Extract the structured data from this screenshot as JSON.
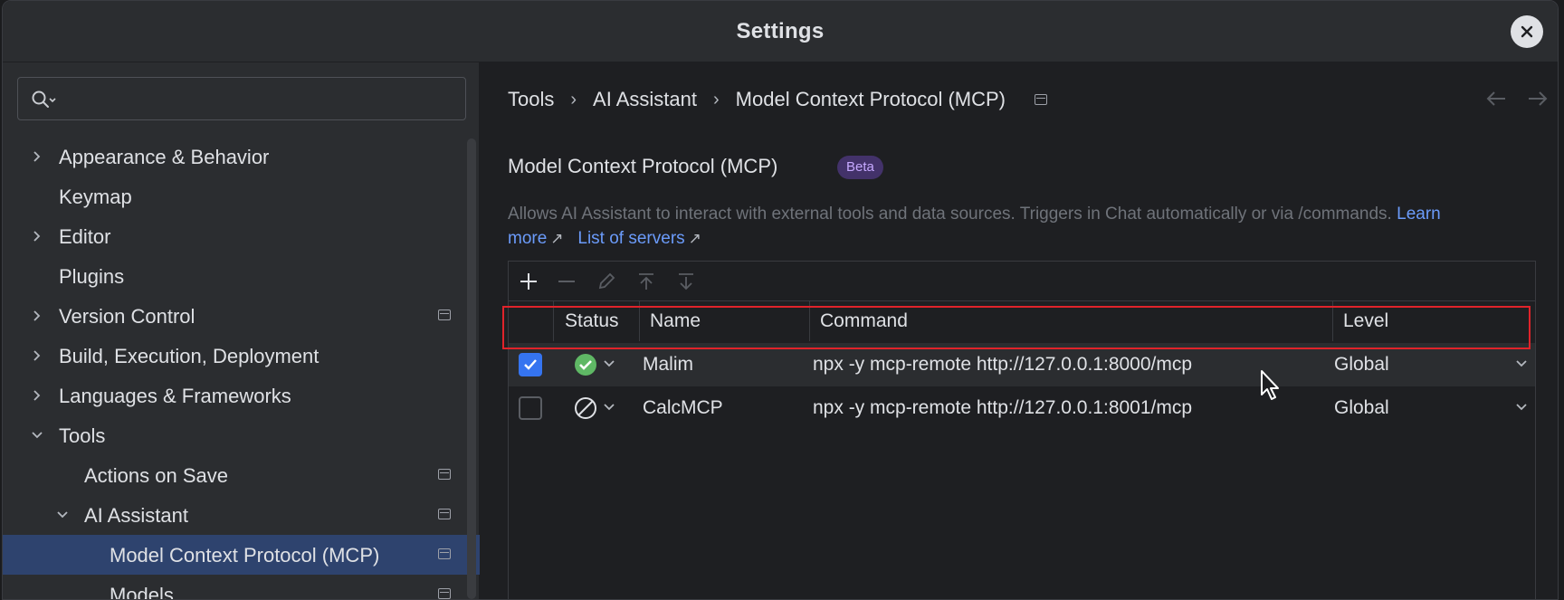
{
  "window": {
    "title": "Settings"
  },
  "sidebar": {
    "search_placeholder": "",
    "items": [
      {
        "label": "Appearance & Behavior",
        "expandable": true,
        "expanded": false,
        "indent": 0,
        "pinned": false
      },
      {
        "label": "Keymap",
        "expandable": false,
        "indent": 0,
        "pinned": false
      },
      {
        "label": "Editor",
        "expandable": true,
        "expanded": false,
        "indent": 0,
        "pinned": false
      },
      {
        "label": "Plugins",
        "expandable": false,
        "indent": 0,
        "pinned": false
      },
      {
        "label": "Version Control",
        "expandable": true,
        "expanded": false,
        "indent": 0,
        "pinned": true
      },
      {
        "label": "Build, Execution, Deployment",
        "expandable": true,
        "expanded": false,
        "indent": 0,
        "pinned": false
      },
      {
        "label": "Languages & Frameworks",
        "expandable": true,
        "expanded": false,
        "indent": 0,
        "pinned": false
      },
      {
        "label": "Tools",
        "expandable": true,
        "expanded": true,
        "indent": 0,
        "pinned": false
      },
      {
        "label": "Actions on Save",
        "expandable": false,
        "indent": 1,
        "pinned": true
      },
      {
        "label": "AI Assistant",
        "expandable": true,
        "expanded": true,
        "indent": 1,
        "pinned": true
      },
      {
        "label": "Model Context Protocol (MCP)",
        "expandable": false,
        "indent": 2,
        "pinned": true,
        "selected": true
      },
      {
        "label": "Models",
        "expandable": false,
        "indent": 2,
        "pinned": true
      }
    ]
  },
  "breadcrumb": {
    "items": [
      "Tools",
      "AI Assistant",
      "Model Context Protocol (MCP)"
    ],
    "separator": "›"
  },
  "main": {
    "title": "Model Context Protocol (MCP)",
    "badge": "Beta",
    "description_text": "Allows AI Assistant to interact with external tools and data sources. Triggers in Chat automatically or via /commands.",
    "learn_more": "Learn more",
    "list_of_servers": "List of servers",
    "ext_arrow": "↗"
  },
  "table": {
    "columns": [
      "Status",
      "Name",
      "Command",
      "Level"
    ],
    "rows": [
      {
        "enabled": true,
        "status": "running",
        "name": "Malim",
        "command": "npx -y mcp-remote http://127.0.0.1:8000/mcp",
        "level": "Global"
      },
      {
        "enabled": false,
        "status": "disabled",
        "name": "CalcMCP",
        "command": "npx -y mcp-remote http://127.0.0.1:8001/mcp",
        "level": "Global"
      }
    ]
  },
  "colors": {
    "accent": "#3574f0",
    "selection": "#2e436e",
    "badge_bg": "#43326a",
    "badge_fg": "#c6a9ff",
    "status_ok": "#5fb865",
    "highlight_border": "#e0232a",
    "link": "#6b9bfa"
  },
  "icons": {
    "search": "search-icon",
    "close": "close-icon",
    "add": "add-icon",
    "remove": "remove-icon",
    "edit": "edit-icon",
    "move_up": "move-up-icon",
    "move_down": "move-down-icon",
    "nav_back": "back-arrow-icon",
    "nav_forward": "forward-arrow-icon",
    "status_ok": "check-circle-icon",
    "status_disabled": "disabled-circle-icon"
  }
}
